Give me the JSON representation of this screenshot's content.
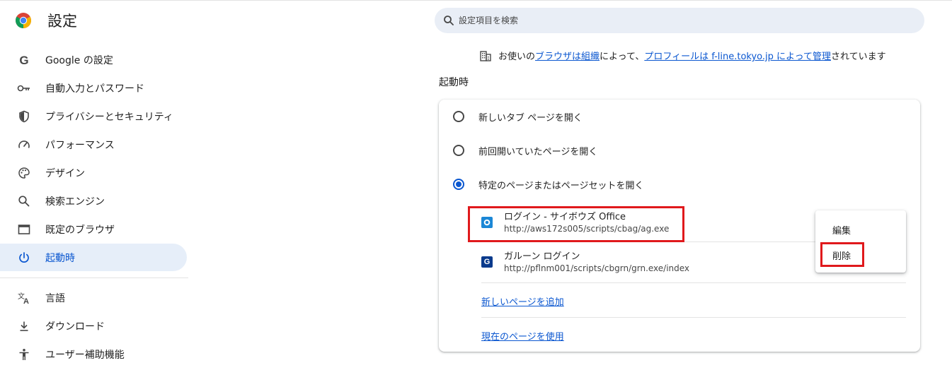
{
  "app": {
    "title": "設定"
  },
  "search": {
    "placeholder": "設定項目を検索",
    "icon": "search-icon"
  },
  "sidebar": {
    "items": [
      {
        "label": "Google の設定",
        "icon": "google-g-icon",
        "active": false
      },
      {
        "label": "自動入力とパスワード",
        "icon": "key-icon",
        "active": false
      },
      {
        "label": "プライバシーとセキュリティ",
        "icon": "shield-icon",
        "active": false
      },
      {
        "label": "パフォーマンス",
        "icon": "speedometer-icon",
        "active": false
      },
      {
        "label": "デザイン",
        "icon": "palette-icon",
        "active": false
      },
      {
        "label": "検索エンジン",
        "icon": "search-icon",
        "active": false
      },
      {
        "label": "既定のブラウザ",
        "icon": "browser-window-icon",
        "active": false
      },
      {
        "label": "起動時",
        "icon": "power-icon",
        "active": true
      },
      {
        "label": "言語",
        "icon": "translate-icon",
        "active": false
      },
      {
        "label": "ダウンロード",
        "icon": "download-icon",
        "active": false
      },
      {
        "label": "ユーザー補助機能",
        "icon": "accessibility-icon",
        "active": false
      }
    ]
  },
  "managed": {
    "prefix": "お使いの",
    "link1": "ブラウザは組織",
    "middle": "によって、",
    "link2": "プロフィールは f-line.tokyo.jp によって管理",
    "suffix": "されています"
  },
  "startup": {
    "section_title": "起動時",
    "options": [
      {
        "label": "新しいタブ ページを開く",
        "checked": false
      },
      {
        "label": "前回開いていたページを開く",
        "checked": false
      },
      {
        "label": "特定のページまたはページセットを開く",
        "checked": true
      }
    ],
    "pages": [
      {
        "title": "ログイン - サイボウズ Office",
        "url": "http://aws172s005/scripts/cbag/ag.exe",
        "favicon": "cybozu-office-icon",
        "favicon_color": "#1b87d6"
      },
      {
        "title": "ガルーン ログイン",
        "url": "http://pflnm001/scripts/cbgrn/grn.exe/index",
        "favicon": "garoon-g-icon",
        "favicon_color": "#0a3a8c",
        "favicon_text": "G"
      }
    ],
    "add_page": "新しいページを追加",
    "use_current": "現在のページを使用"
  },
  "context_menu": {
    "edit": "編集",
    "delete": "削除"
  },
  "colors": {
    "accent": "#0b57d0",
    "highlight": "#e0191c",
    "active_bg": "#e6eef9"
  }
}
